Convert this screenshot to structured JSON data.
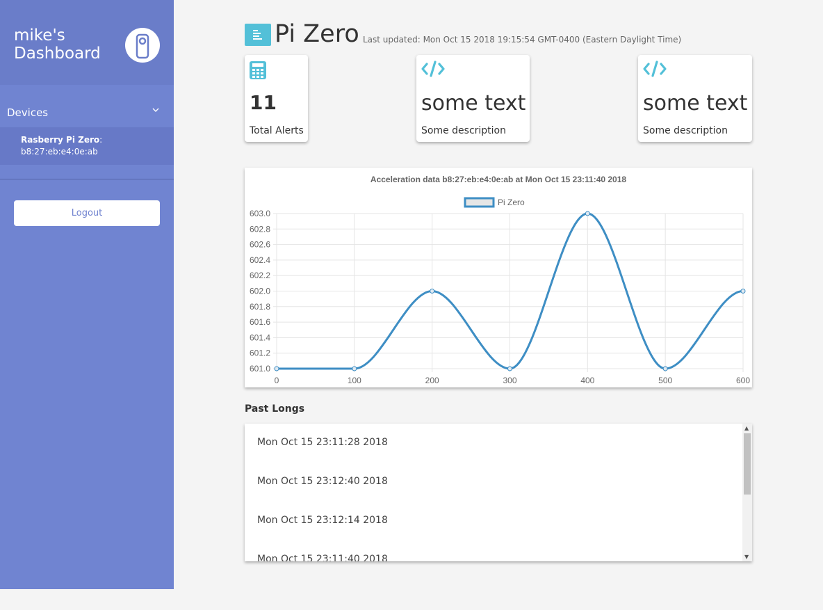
{
  "sidebar": {
    "brand_title_line1": "mike's",
    "brand_title_line2": "Dashboard",
    "logo_icon": "door-hanger-icon",
    "devices_label": "Devices",
    "device": {
      "name": "Rasberry Pi Zero",
      "separator": ":",
      "mac": "b8:27:eb:e4:0e:ab"
    },
    "logout_label": "Logout",
    "colors": {
      "background": "#7084d1",
      "brand": "#6a7dc9",
      "device_item": "#6779c7"
    }
  },
  "header": {
    "icon": "list-align-left-icon",
    "title": "Pi Zero",
    "last_updated": "Last updated: Mon Oct 15 2018 19:15:54 GMT-0400 (Eastern Daylight Time)"
  },
  "cards": [
    {
      "icon": "calculator-icon",
      "value": "11",
      "description": "Total Alerts"
    },
    {
      "icon": "code-icon",
      "value": "some text",
      "description": "Some description"
    },
    {
      "icon": "code-icon",
      "value": "some text",
      "description": "Some description"
    }
  ],
  "accent_color": "#53c0d8",
  "chart_data": {
    "type": "line",
    "title": "Acceleration data b8:27:eb:e4:0e:ab at Mon Oct 15 23:11:40  2018",
    "x": [
      0,
      100,
      200,
      300,
      400,
      500,
      600
    ],
    "series": [
      {
        "name": "Pi Zero",
        "values": [
          601.0,
          601.0,
          602.0,
          601.0,
          603.0,
          601.0,
          602.0
        ],
        "color": "#3e8ec4"
      }
    ],
    "xlim": [
      0,
      600
    ],
    "ylim": [
      601.0,
      603.0
    ],
    "xticks": [
      "0",
      "100",
      "200",
      "300",
      "400",
      "500",
      "600"
    ],
    "yticks": [
      "601.0",
      "601.2",
      "601.4",
      "601.6",
      "601.8",
      "602.0",
      "602.2",
      "602.4",
      "602.6",
      "602.8",
      "603.0"
    ],
    "legend": "top-center",
    "grid": true
  },
  "past_logs": {
    "title": "Past Longs",
    "items": [
      "Mon Oct 15 23:11:28 2018",
      "Mon Oct 15 23:12:40 2018",
      "Mon Oct 15 23:12:14 2018",
      "Mon Oct 15 23:11:40 2018"
    ]
  }
}
